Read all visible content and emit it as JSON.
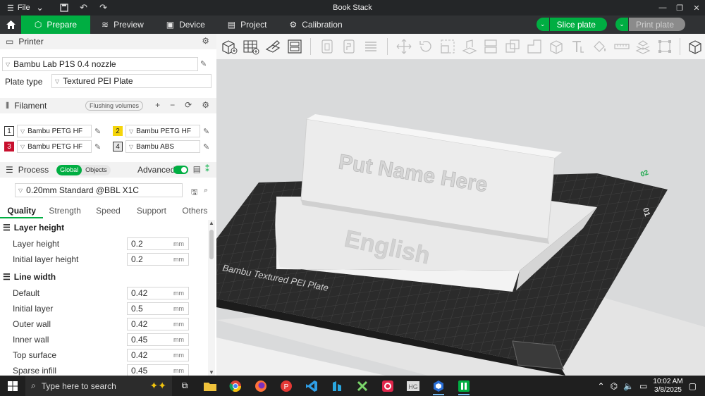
{
  "titlebar": {
    "file_label": "File",
    "app_title": "Book Stack"
  },
  "nav": {
    "tabs": [
      {
        "label": "Prepare"
      },
      {
        "label": "Preview"
      },
      {
        "label": "Device"
      },
      {
        "label": "Project"
      },
      {
        "label": "Calibration"
      }
    ],
    "slice_label": "Slice plate",
    "print_label": "Print plate"
  },
  "printer": {
    "section_title": "Printer",
    "printer_name": "Bambu Lab P1S 0.4 nozzle",
    "plate_type_label": "Plate type",
    "plate_type_value": "Textured PEI Plate"
  },
  "filament": {
    "section_title": "Filament",
    "flushing_label": "Flushing volumes",
    "slots": [
      {
        "num": "1",
        "name": "Bambu PETG HF",
        "color": "#ffffff"
      },
      {
        "num": "2",
        "name": "Bambu PETG HF",
        "color": "#f5d50a"
      },
      {
        "num": "3",
        "name": "Bambu PETG HF",
        "color": "#c8102e"
      },
      {
        "num": "4",
        "name": "Bambu ABS",
        "color": "#e6e6e6"
      }
    ]
  },
  "process": {
    "section_title": "Process",
    "global_label": "Global",
    "objects_label": "Objects",
    "advanced_label": "Advanced",
    "preset": "0.20mm Standard @BBL X1C",
    "tabs": [
      "Quality",
      "Strength",
      "Speed",
      "Support",
      "Others"
    ]
  },
  "quality": {
    "layer_height_title": "Layer height",
    "layer_height": {
      "label": "Layer height",
      "value": "0.2",
      "unit": "mm"
    },
    "initial_layer_height": {
      "label": "Initial layer height",
      "value": "0.2",
      "unit": "mm"
    },
    "line_width_title": "Line width",
    "line_widths": [
      {
        "label": "Default",
        "value": "0.42",
        "unit": "mm"
      },
      {
        "label": "Initial layer",
        "value": "0.5",
        "unit": "mm"
      },
      {
        "label": "Outer wall",
        "value": "0.42",
        "unit": "mm"
      },
      {
        "label": "Inner wall",
        "value": "0.45",
        "unit": "mm"
      },
      {
        "label": "Top surface",
        "value": "0.42",
        "unit": "mm"
      },
      {
        "label": "Sparse infill",
        "value": "0.45",
        "unit": "mm"
      }
    ]
  },
  "model": {
    "sign_text": "Put Name Here",
    "base_text": "English",
    "plate_text": "Bambu Textured PEI Plate",
    "plate_number": "01"
  },
  "taskbar": {
    "search_placeholder": "Type here to search",
    "time": "10:02 AM",
    "date": "3/8/2025"
  },
  "colors": {
    "accent": "#00ae42",
    "nav_bg": "#303234",
    "titlebar_bg": "#242628"
  }
}
